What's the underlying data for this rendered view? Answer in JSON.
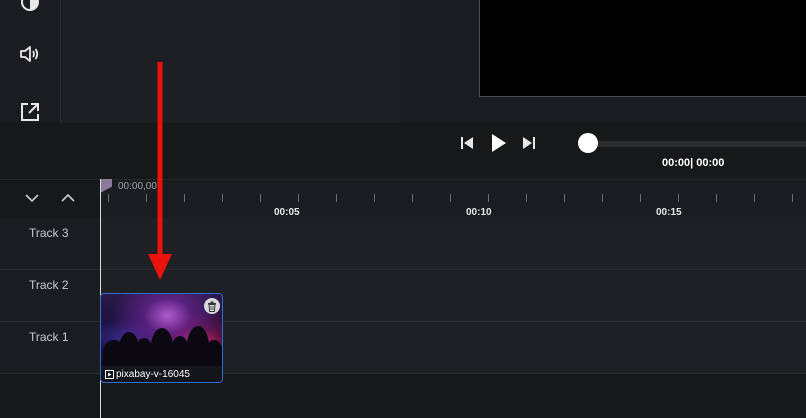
{
  "player": {
    "time_current": "00:00",
    "time_separator": "|",
    "time_total": "00:00",
    "progress_fraction": 0
  },
  "timeline": {
    "playhead_time": "00:00,00",
    "ruler_labels": [
      "00:05",
      "00:10",
      "00:15"
    ]
  },
  "tracks": [
    {
      "label": "Track 3"
    },
    {
      "label": "Track 2"
    },
    {
      "label": "Track 1"
    }
  ],
  "clip": {
    "name": "pixabay-v-16045"
  },
  "annotation": {
    "arrow_color": "#e8140c"
  },
  "colors": {
    "clip_border": "#2f6fd6",
    "accent_white": "#ffffff"
  }
}
